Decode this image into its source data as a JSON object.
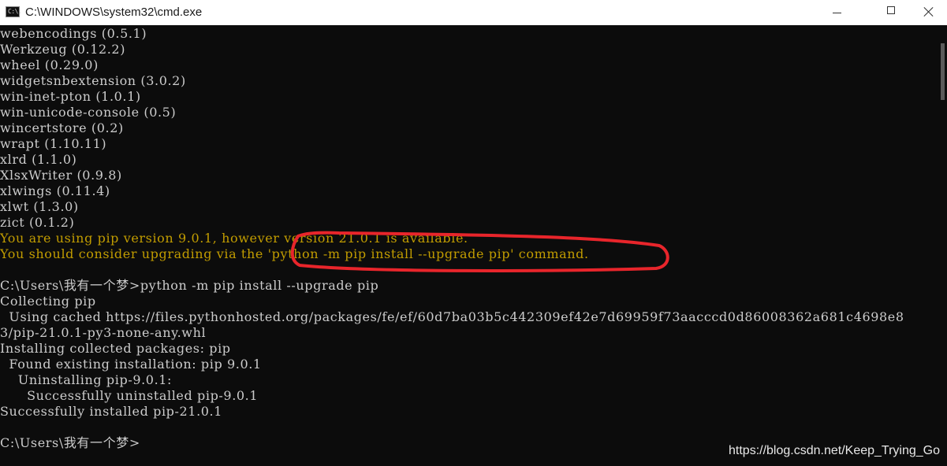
{
  "window": {
    "title": "C:\\WINDOWS\\system32\\cmd.exe",
    "icon": "cmd-icon",
    "icon_text": "C:\\."
  },
  "console": {
    "lines": [
      "webencodings (0.5.1)",
      "Werkzeug (0.12.2)",
      "wheel (0.29.0)",
      "widgetsnbextension (3.0.2)",
      "win-inet-pton (1.0.1)",
      "win-unicode-console (0.5)",
      "wincertstore (0.2)",
      "wrapt (1.10.11)",
      "xlrd (1.1.0)",
      "XlsxWriter (0.9.8)",
      "xlwings (0.11.4)",
      "xlwt (1.3.0)",
      "zict (0.1.2)",
      "You are using pip version 9.0.1, however version 21.0.1 is available.",
      "You should consider upgrading via the 'python -m pip install --upgrade pip' command.",
      "",
      "C:\\Users\\我有一个梦>python -m pip install --upgrade pip",
      "Collecting pip",
      "  Using cached https://files.pythonhosted.org/packages/fe/ef/60d7ba03b5c442309ef42e7d69959f73aacccd0d86008362a681c4698e8",
      "3/pip-21.0.1-py3-none-any.whl",
      "Installing collected packages: pip",
      "  Found existing installation: pip 9.0.1",
      "    Uninstalling pip-9.0.1:",
      "      Successfully uninstalled pip-9.0.1",
      "Successfully installed pip-21.0.1",
      "",
      "C:\\Users\\我有一个梦>"
    ]
  },
  "colors": {
    "background": "#0c0c0c",
    "text": "#cccccc",
    "warning": "#c19c00",
    "annotation": "#e8252b"
  },
  "watermark": "https://blog.csdn.net/Keep_Trying_Go"
}
